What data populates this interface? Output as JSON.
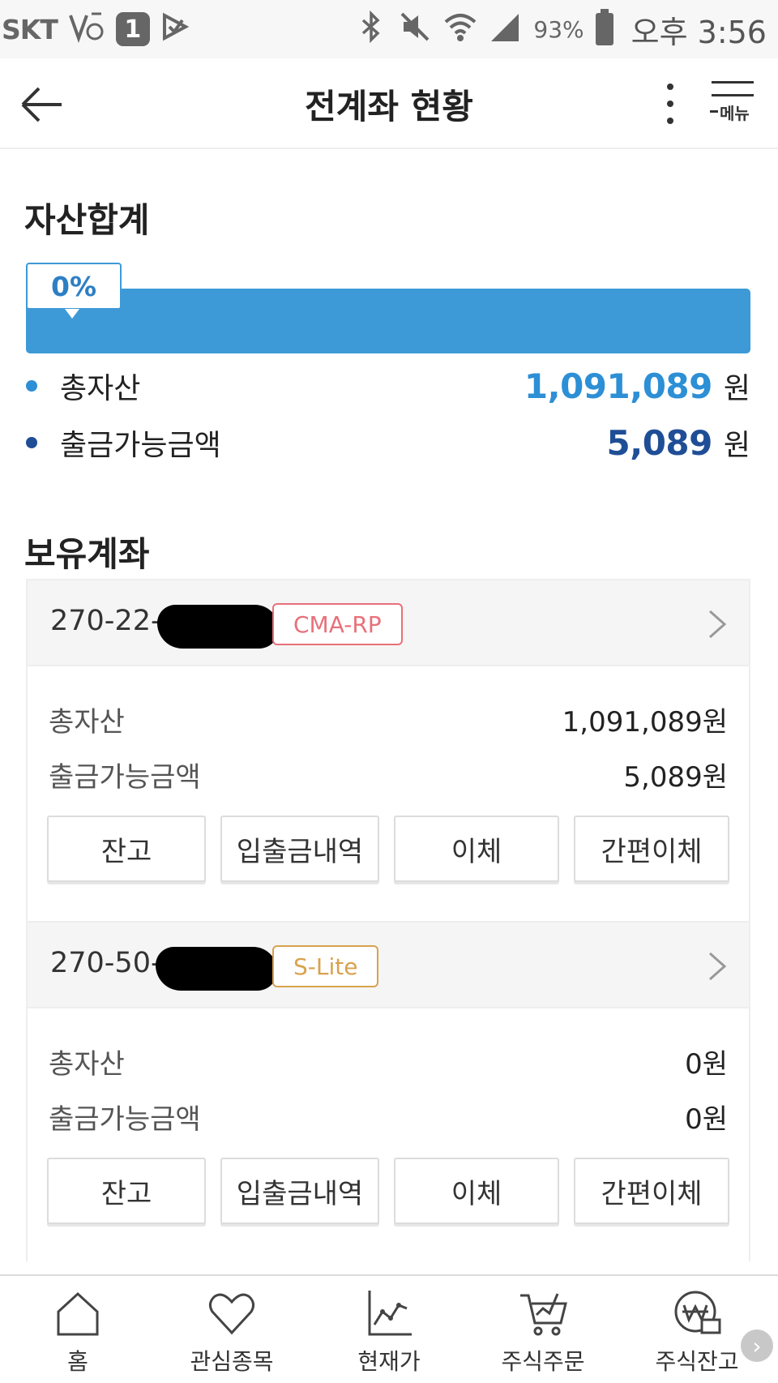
{
  "status_bar": {
    "carrier": "SKT",
    "notification_count": "1",
    "battery_percent": "93%",
    "time": "오후 3:56"
  },
  "header": {
    "title": "전계좌 현황",
    "menu_label": "메뉴"
  },
  "asset_summary": {
    "title": "자산합계",
    "withdrawable_ratio_label": "0%",
    "withdrawable_ratio": 0.0,
    "items": [
      {
        "label": "총자산",
        "value": "1,091,089",
        "unit": "원",
        "color": "#2d8fd5"
      },
      {
        "label": "출금가능금액",
        "value": "5,089",
        "unit": "원",
        "color": "#1f4e96"
      }
    ]
  },
  "accounts_section": {
    "title": "보유계좌",
    "accounts": [
      {
        "number_prefix": "270-22-",
        "type": "CMA-RP",
        "tag_color": "#e8707a",
        "total_label": "총자산",
        "total_value": "1,091,089원",
        "withdrawable_label": "출금가능금액",
        "withdrawable_value": "5,089원",
        "buttons": [
          "잔고",
          "입출금내역",
          "이체",
          "간편이체"
        ]
      },
      {
        "number_prefix": "270-50-",
        "type": "S-Lite",
        "tag_color": "#d8a24e",
        "total_label": "총자산",
        "total_value": "0원",
        "withdrawable_label": "출금가능금액",
        "withdrawable_value": "0원",
        "buttons": [
          "잔고",
          "입출금내역",
          "이체",
          "간편이체"
        ]
      }
    ]
  },
  "bottom_nav": {
    "items": [
      {
        "label": "홈",
        "icon": "home-icon"
      },
      {
        "label": "관심종목",
        "icon": "heart-icon"
      },
      {
        "label": "현재가",
        "icon": "line-chart-icon"
      },
      {
        "label": "주식주문",
        "icon": "cart-chart-icon"
      },
      {
        "label": "주식잔고",
        "icon": "won-coin-icon"
      }
    ]
  }
}
